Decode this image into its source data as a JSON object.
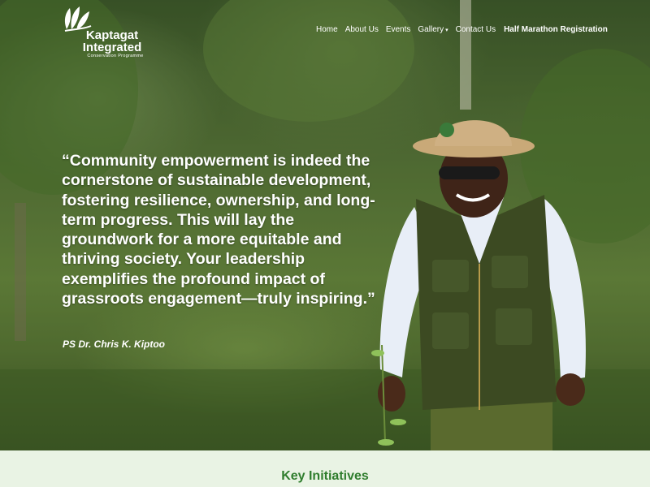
{
  "brand": {
    "name_line1": "Kaptagat",
    "name_line2": "Integrated",
    "tagline": "Conservation Programme",
    "logo_icon": "leaves-icon"
  },
  "nav": {
    "items": [
      {
        "label": "Home"
      },
      {
        "label": "About Us"
      },
      {
        "label": "Events"
      },
      {
        "label": "Gallery",
        "has_dropdown": true
      },
      {
        "label": "Contact Us"
      },
      {
        "label": "Half Marathon Registration",
        "emphasis": true
      }
    ]
  },
  "hero": {
    "quote": "“Community empowerment is indeed the cornerstone of sustainable development, fostering resilience, ownership, and long-term progress. This will lay the groundwork for a more equitable and thriving society. Your leadership exemplifies the profound impact of grassroots engagement—truly inspiring.”",
    "author": "PS Dr. Chris K. Kiptoo"
  },
  "section": {
    "title": "Key Initiatives"
  },
  "colors": {
    "accent_green": "#2f7d2d",
    "band_background": "#e9f3e4"
  }
}
